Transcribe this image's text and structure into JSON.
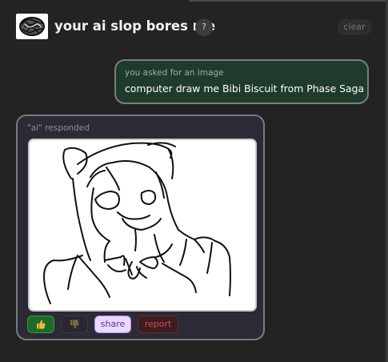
{
  "header": {
    "title": "your ai slop bores me",
    "help_label": "?",
    "clear_label": "clear",
    "logo_icon": "scribble-logo-icon"
  },
  "user_message": {
    "label": "you asked for an image",
    "text": "computer draw me Bibi Biscuit from Phase Saga",
    "background": "#1f3b2b"
  },
  "ai_message": {
    "label": "\"ai\" responded",
    "image": "hand-drawn-sketch-of-character",
    "background": "#2c2a34"
  },
  "actions": {
    "like_icon": "thumbs-up-icon",
    "dislike_icon": "thumbs-down-icon",
    "share_label": "share",
    "report_label": "report"
  },
  "colors": {
    "page_bg": "#232323",
    "like_bg": "#1f6a2a",
    "share_bg": "#e9d8ff",
    "report_text": "#e24848"
  }
}
